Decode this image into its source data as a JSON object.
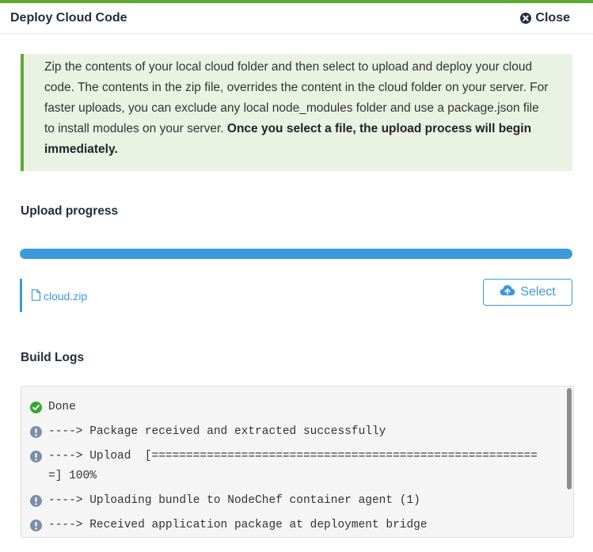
{
  "dialog": {
    "title": "Deploy Cloud Code",
    "close_label": "Close"
  },
  "notice": {
    "text": "Zip the contents of your local cloud folder and then select to upload and deploy your cloud code. The contents in the zip file, overrides the content in the cloud folder on your server. For faster uploads, you can exclude any local node_modules folder and use a package.json file to install modules on your server. ",
    "bold_text": "Once you select a file, the upload process will begin immediately."
  },
  "upload": {
    "title": "Upload progress",
    "progress_percent": 100,
    "file_name": "cloud.zip",
    "select_label": "Select"
  },
  "logs": {
    "title": "Build Logs",
    "entries": [
      {
        "status": "success",
        "icon": "check-circle-icon",
        "text": "Done"
      },
      {
        "status": "info",
        "icon": "exclamation-circle-icon",
        "text": "----> Package received and extracted successfully"
      },
      {
        "status": "info",
        "icon": "exclamation-circle-icon",
        "text": "----> Upload  [=========================================================] 100%"
      },
      {
        "status": "info",
        "icon": "exclamation-circle-icon",
        "text": "----> Uploading bundle to NodeChef container agent (1)"
      },
      {
        "status": "info",
        "icon": "exclamation-circle-icon",
        "text": "----> Received application package at deployment bridge"
      }
    ]
  },
  "colors": {
    "accent": "#5eab34",
    "primary": "#3c99dc",
    "success": "#2fa82f",
    "info": "#7b8ea8"
  }
}
